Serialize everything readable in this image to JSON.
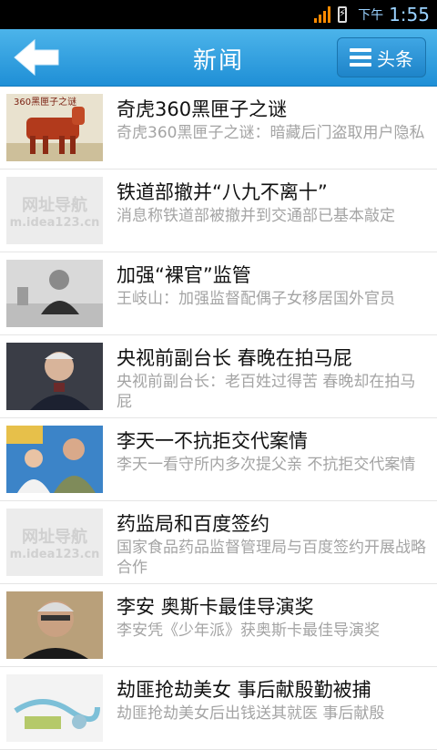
{
  "status_bar": {
    "ampm": "下午",
    "time": "1:55"
  },
  "header": {
    "title": "新闻",
    "category_label": "头条"
  },
  "placeholder": {
    "line1": "网址导航",
    "line2": "m.idea123.cn"
  },
  "thumbnail_texts": {
    "item1": "360黑匣子之谜"
  },
  "news": [
    {
      "headline": "奇虎360黑匣子之谜",
      "summary": "奇虎360黑匣子之谜：暗藏后门盗取用户隐私"
    },
    {
      "headline": "铁道部撤并“八九不离十”",
      "summary": "消息称铁道部被撤并到交通部已基本敲定"
    },
    {
      "headline": "加强“裸官”监管",
      "summary": "王岐山：加强监督配偶子女移居国外官员"
    },
    {
      "headline": "央视前副台长 春晚在拍马屁",
      "summary": "央视前副台长：老百姓过得苦 春晚却在拍马屁"
    },
    {
      "headline": "李天一不抗拒交代案情",
      "summary": "李天一看守所内多次提父亲 不抗拒交代案情"
    },
    {
      "headline": "药监局和百度签约",
      "summary": "国家食品药品监督管理局与百度签约开展战略合作"
    },
    {
      "headline": "李安 奥斯卡最佳导演奖",
      "summary": "李安凭《少年派》获奥斯卡最佳导演奖"
    },
    {
      "headline": "劫匪抢劫美女 事后献殷勤被捕",
      "summary": "劫匪抢劫美女后出钱送其就医 事后献殷"
    }
  ]
}
